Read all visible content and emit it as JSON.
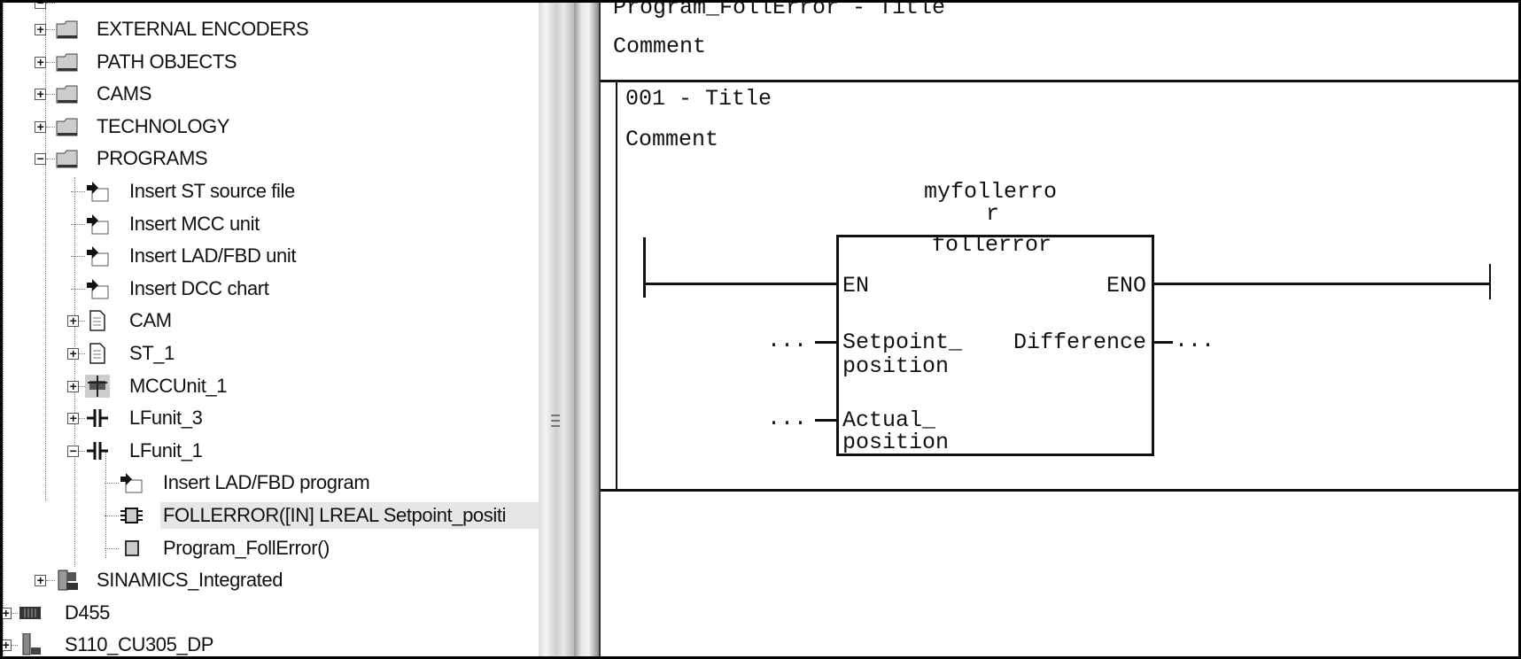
{
  "tree": {
    "items": [
      {
        "label": "",
        "icon": "device-icon",
        "expander": "minus",
        "level": 1,
        "partial": true
      },
      {
        "label": "EXTERNAL ENCODERS",
        "icon": "folder-icon",
        "expander": "plus",
        "level": 1
      },
      {
        "label": "PATH OBJECTS",
        "icon": "folder-icon",
        "expander": "plus",
        "level": 1
      },
      {
        "label": "CAMS",
        "icon": "folder-icon",
        "expander": "plus",
        "level": 1
      },
      {
        "label": "TECHNOLOGY",
        "icon": "folder-icon",
        "expander": "plus",
        "level": 1
      },
      {
        "label": "PROGRAMS",
        "icon": "folder-icon",
        "expander": "minus",
        "level": 1
      },
      {
        "label": "Insert ST source file",
        "icon": "insert-arrow-icon",
        "expander": "",
        "level": 2
      },
      {
        "label": "Insert MCC unit",
        "icon": "insert-arrow-icon",
        "expander": "",
        "level": 2
      },
      {
        "label": "Insert LAD/FBD unit",
        "icon": "insert-arrow-icon",
        "expander": "",
        "level": 2
      },
      {
        "label": "Insert DCC chart",
        "icon": "insert-arrow-icon",
        "expander": "",
        "level": 2
      },
      {
        "label": "CAM",
        "icon": "document-icon",
        "expander": "plus",
        "level": 2
      },
      {
        "label": "ST_1",
        "icon": "document-icon",
        "expander": "plus",
        "level": 2
      },
      {
        "label": "MCCUnit_1",
        "icon": "mcc-unit-icon",
        "expander": "plus",
        "level": 2
      },
      {
        "label": "LFunit_3",
        "icon": "lad-contact-icon",
        "expander": "plus",
        "level": 2
      },
      {
        "label": "LFunit_1",
        "icon": "lad-contact-icon",
        "expander": "minus",
        "level": 2
      },
      {
        "label": "Insert LAD/FBD program",
        "icon": "insert-arrow-icon",
        "expander": "",
        "level": 3
      },
      {
        "label": "FOLLERROR([IN] LREAL Setpoint_positi",
        "icon": "function-block-icon",
        "expander": "",
        "level": 3,
        "selected": true
      },
      {
        "label": "Program_FollError()",
        "icon": "program-icon",
        "expander": "",
        "level": 3
      },
      {
        "label": "SINAMICS_Integrated",
        "icon": "drive-icon",
        "expander": "plus",
        "level": 1
      },
      {
        "label": "D455",
        "icon": "controller-icon",
        "expander": "plus",
        "level": 0
      },
      {
        "label": "S110_CU305_DP",
        "icon": "drive-unit-icon",
        "expander": "plus",
        "level": 0
      }
    ]
  },
  "editor": {
    "program_title": "Program_FollError - Title",
    "program_comment": "Comment",
    "network": {
      "title": "001 - Title",
      "comment": "Comment",
      "instance_line1": "myfollerro",
      "instance_line2": "r",
      "block_type": "follerror",
      "en": "EN",
      "eno": "ENO",
      "in1_line1": "Setpoint_",
      "in1_line2": "position",
      "in2_line1": "Actual_",
      "in2_line2": "position",
      "out1": "Difference",
      "placeholder": "..."
    }
  }
}
